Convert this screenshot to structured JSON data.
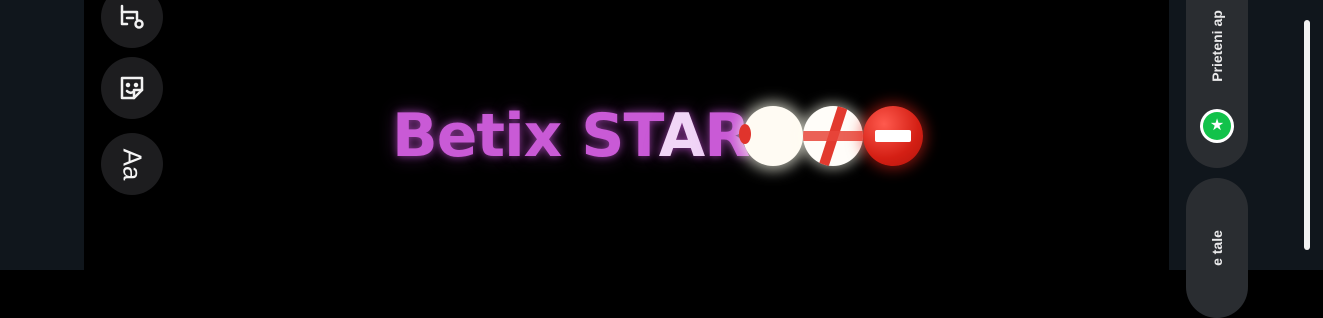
{
  "editor": {
    "caption_main": "Betix ST",
    "caption_highlight": "A",
    "caption_tail": "R",
    "caption_color": "#c95ad6",
    "emojis": [
      "white-circle-emoji",
      "no-pedestrians-sign-emoji",
      "no-entry-emoji"
    ]
  },
  "tools": [
    {
      "name": "stickers-tool",
      "icon": "sticker-icon"
    },
    {
      "name": "emoji-tool",
      "icon": "smiley-sticker-icon"
    },
    {
      "name": "text-tool",
      "icon": "text-aa-icon",
      "label": "Aa"
    }
  ],
  "share_panel": {
    "pill1_label": "Prieteni ap",
    "pill2_label": "e tale",
    "badge_icon": "green-star-icon",
    "badge_color": "#12c24a"
  }
}
